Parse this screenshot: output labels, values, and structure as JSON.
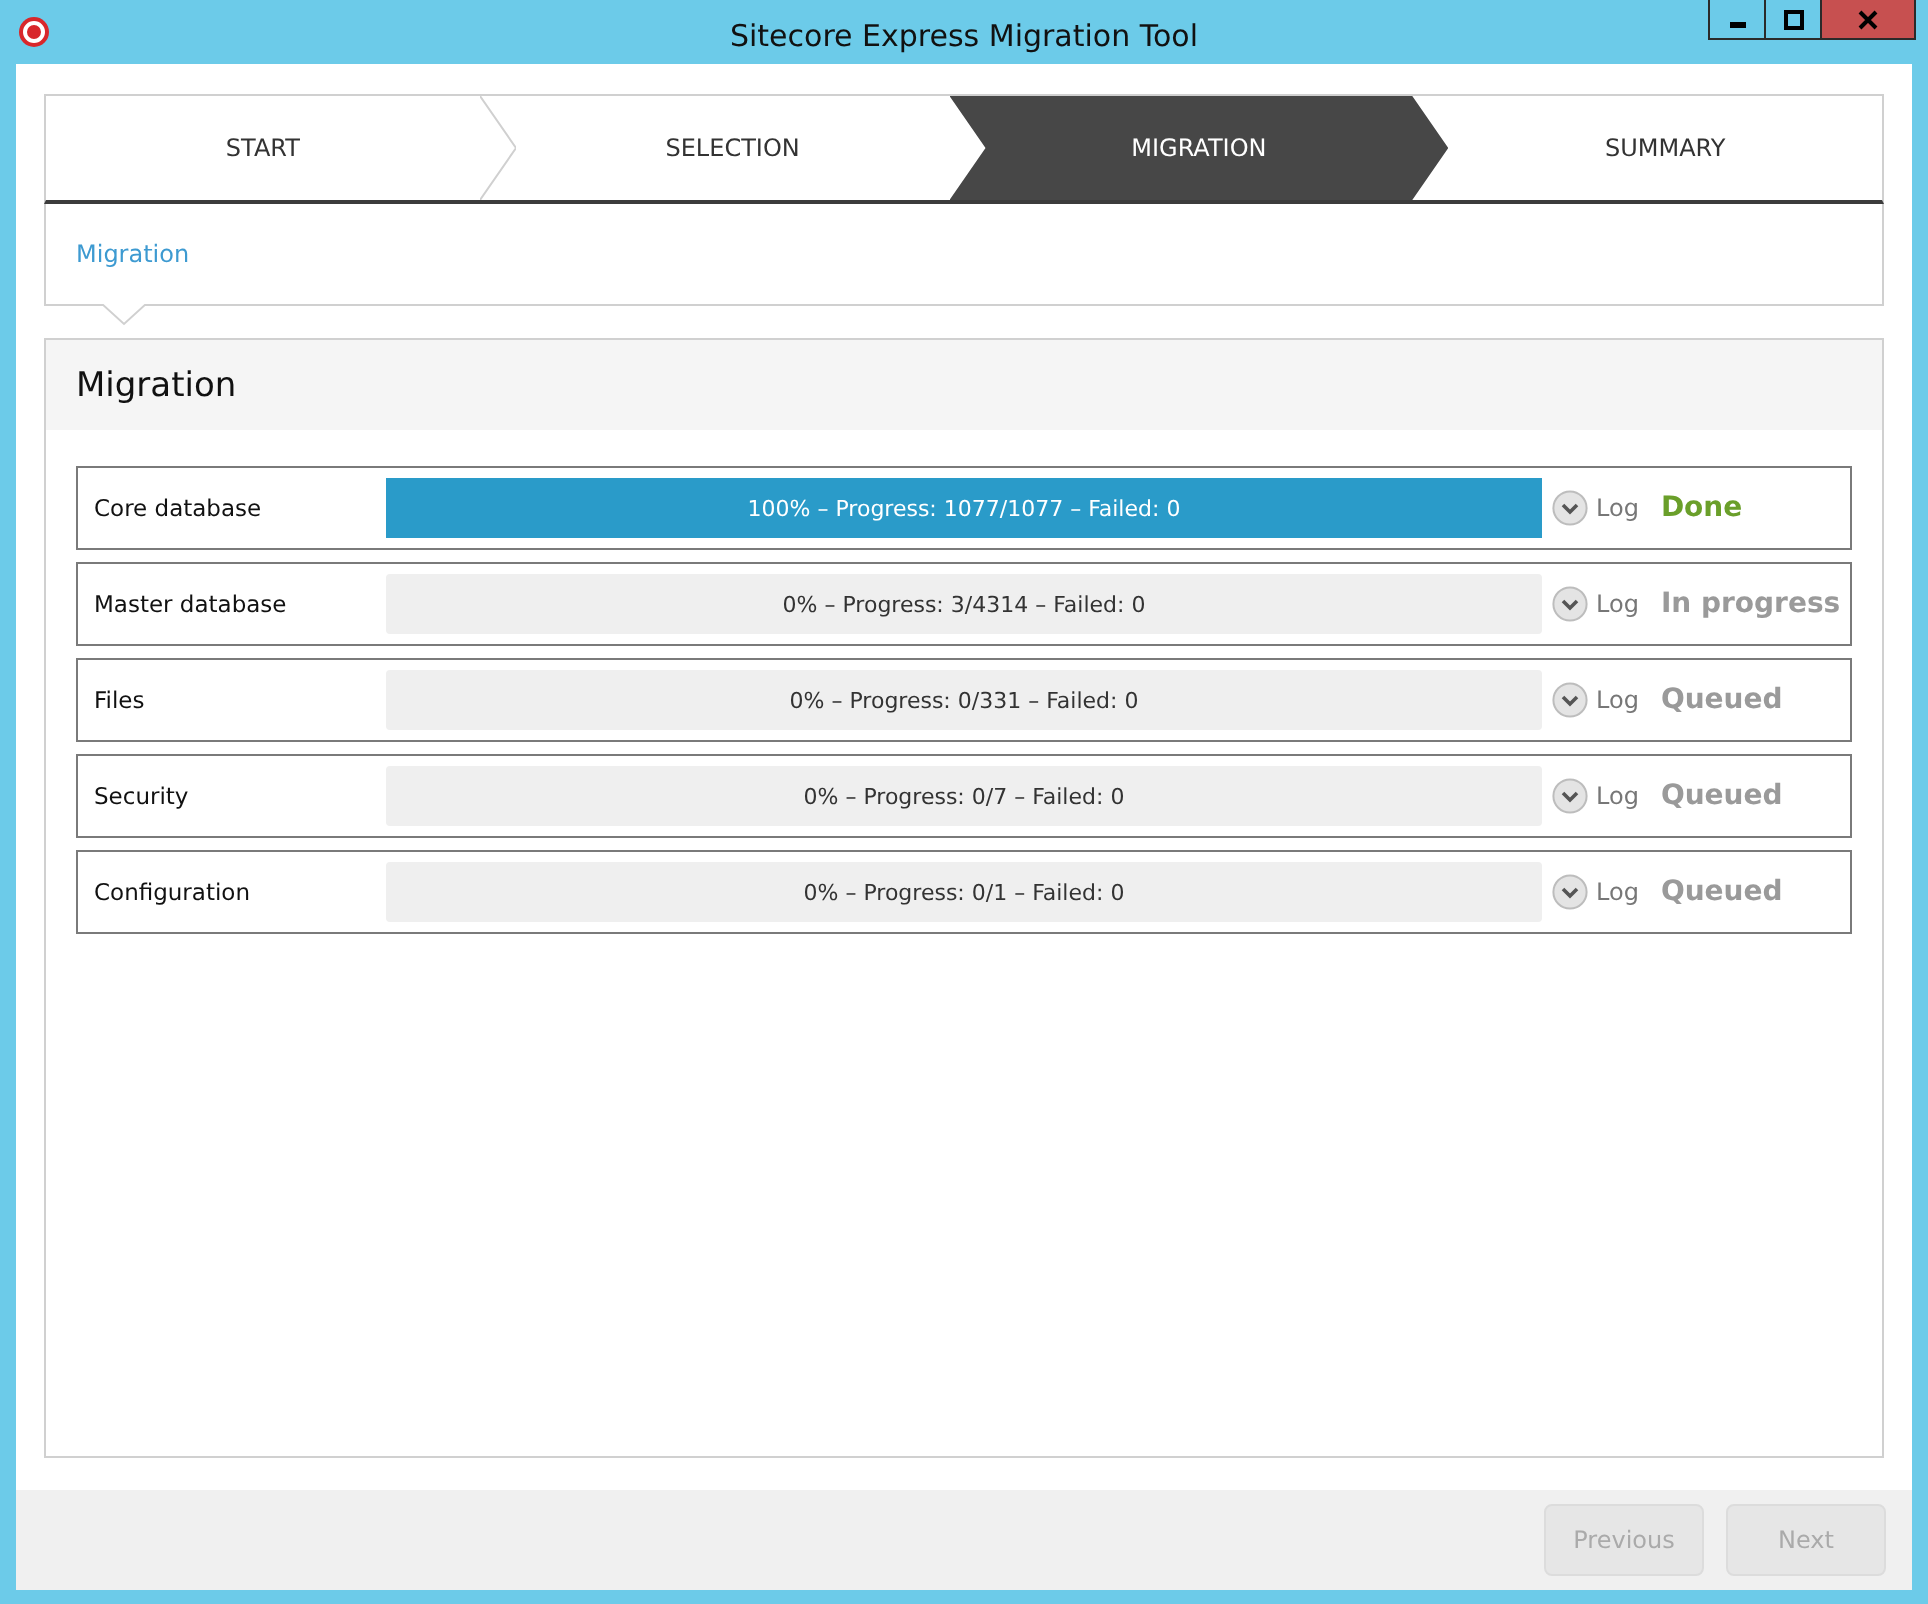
{
  "window": {
    "title": "Sitecore Express Migration Tool"
  },
  "steps": [
    {
      "label": "START",
      "selected": false
    },
    {
      "label": "SELECTION",
      "selected": false
    },
    {
      "label": "MIGRATION",
      "selected": true
    },
    {
      "label": "SUMMARY",
      "selected": false
    }
  ],
  "breadcrumb": "Migration",
  "panel": {
    "title": "Migration"
  },
  "tasks": [
    {
      "name": "Core database",
      "level": 1,
      "progress": "100% – Progress: 1077/1077 – Failed: 0",
      "log": "Log",
      "status": {
        "kind": "done",
        "label": "Done"
      }
    },
    {
      "name": "Master database",
      "level": 0,
      "progress": "0% – Progress: 3/4314 – Failed: 0",
      "log": "Log",
      "status": {
        "kind": "in_progress",
        "label": "In progress"
      }
    },
    {
      "name": "Files",
      "level": 0,
      "progress": "0% – Progress: 0/331 – Failed: 0",
      "log": "Log",
      "status": {
        "kind": "queued",
        "label": "Queued"
      }
    },
    {
      "name": "Security",
      "level": 0,
      "progress": "0% – Progress: 0/7 – Failed: 0",
      "log": "Log",
      "status": {
        "kind": "queued",
        "label": "Queued"
      }
    },
    {
      "name": "Configuration",
      "level": 0,
      "progress": "0% – Progress: 0/1 – Failed: 0",
      "log": "Log",
      "status": {
        "kind": "queued",
        "label": "Queued"
      }
    }
  ],
  "buttons": [
    {
      "label": "Previous",
      "disabled": true
    },
    {
      "label": "Next",
      "disabled": true
    }
  ]
}
